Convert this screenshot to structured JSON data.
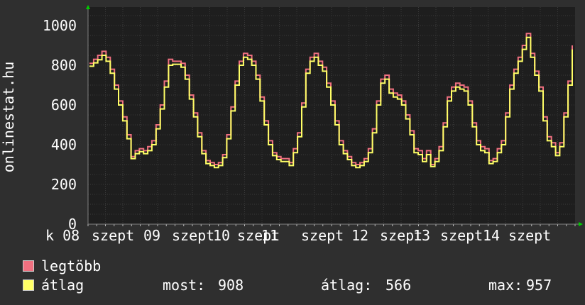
{
  "chart_data": {
    "type": "line",
    "ylabel": "onlinestat.hu",
    "ylim": [
      0,
      1000
    ],
    "yticks": [
      0,
      200,
      400,
      600,
      800,
      1000
    ],
    "xtick_labels": [
      "k 08",
      "szept",
      "09",
      "szept",
      "10",
      "szept",
      "11",
      "szept",
      "12",
      "szept",
      "13",
      "szept",
      "14",
      "szept"
    ],
    "grid": true,
    "series": [
      {
        "name": "legtöbb",
        "color": "#f07080",
        "values": [
          810,
          830,
          850,
          870,
          840,
          780,
          700,
          620,
          540,
          450,
          340,
          370,
          380,
          370,
          390,
          420,
          500,
          600,
          720,
          830,
          820,
          820,
          810,
          750,
          650,
          560,
          460,
          370,
          320,
          310,
          300,
          310,
          350,
          450,
          590,
          720,
          820,
          860,
          850,
          820,
          750,
          640,
          520,
          420,
          360,
          340,
          330,
          330,
          310,
          380,
          460,
          610,
          780,
          840,
          860,
          820,
          790,
          710,
          620,
          520,
          420,
          370,
          340,
          310,
          300,
          310,
          330,
          380,
          480,
          620,
          730,
          750,
          680,
          660,
          650,
          620,
          550,
          470,
          380,
          370,
          330,
          370,
          300,
          330,
          390,
          510,
          640,
          690,
          710,
          700,
          690,
          620,
          510,
          420,
          390,
          380,
          320,
          330,
          380,
          420,
          560,
          700,
          780,
          840,
          900,
          960,
          860,
          770,
          690,
          540,
          440,
          410,
          360,
          410,
          560,
          720,
          900
        ]
      },
      {
        "name": "átlag",
        "color": "#ffff66",
        "values": [
          795,
          812,
          828,
          850,
          820,
          760,
          680,
          600,
          520,
          430,
          330,
          355,
          365,
          355,
          370,
          400,
          480,
          580,
          690,
          800,
          805,
          805,
          790,
          730,
          630,
          540,
          440,
          355,
          305,
          295,
          285,
          295,
          335,
          430,
          570,
          700,
          800,
          840,
          830,
          800,
          730,
          620,
          500,
          400,
          345,
          325,
          315,
          315,
          295,
          360,
          440,
          590,
          760,
          820,
          840,
          800,
          770,
          690,
          600,
          500,
          400,
          355,
          325,
          295,
          285,
          295,
          315,
          360,
          460,
          600,
          710,
          730,
          660,
          640,
          630,
          600,
          530,
          450,
          360,
          350,
          315,
          350,
          290,
          315,
          370,
          490,
          620,
          670,
          690,
          680,
          670,
          600,
          490,
          400,
          370,
          360,
          305,
          315,
          360,
          400,
          540,
          680,
          760,
          820,
          880,
          940,
          840,
          750,
          670,
          520,
          420,
          390,
          345,
          390,
          540,
          700,
          880
        ]
      }
    ],
    "stats": {
      "most_label": "most:",
      "most_value": "908",
      "atlag_label": "átlag:",
      "atlag_value": "566",
      "max_label": "max:",
      "max_value": "957"
    }
  },
  "colors": {
    "background": "#2f2f2f",
    "plot_background": "#1e1e1e",
    "grid": "#3a3a3a",
    "axis": "#808080",
    "arrow": "#00cc00"
  }
}
